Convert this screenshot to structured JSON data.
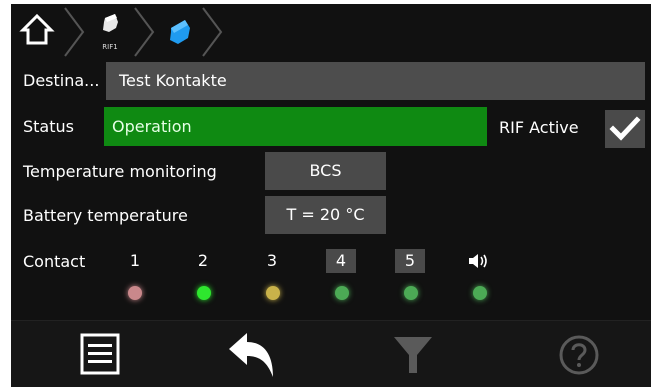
{
  "breadcrumb": {
    "home_icon": "home-icon",
    "item1_label": "RIF1",
    "item1_icon": "device-icon",
    "item2_icon": "device-icon-active"
  },
  "destination": {
    "label": "Destina...",
    "value": "Test Kontakte"
  },
  "status": {
    "label": "Status",
    "value": "Operation",
    "color": "#0f8a12"
  },
  "rif_active": {
    "label": "RIF Active",
    "checked": true
  },
  "temperature_monitoring": {
    "label": "Temperature monitoring",
    "value": "BCS"
  },
  "battery_temperature": {
    "label": "Battery temperature",
    "value": "T = 20 °C"
  },
  "contacts": {
    "label": "Contact",
    "items": [
      {
        "number": "1",
        "boxed": false,
        "led_color": "#c9888b"
      },
      {
        "number": "2",
        "boxed": false,
        "led_color": "#2ee62e"
      },
      {
        "number": "3",
        "boxed": false,
        "led_color": "#c9b24a"
      },
      {
        "number": "4",
        "boxed": true,
        "led_color": "#4caa55"
      },
      {
        "number": "5",
        "boxed": true,
        "led_color": "#4caa55"
      }
    ],
    "speaker": {
      "icon": "speaker-icon",
      "led_color": "#4caa55"
    }
  },
  "toolbar": {
    "menu_icon": "menu-list-icon",
    "back_icon": "back-arrow-icon",
    "filter_icon": "filter-icon",
    "help_icon": "help-icon"
  }
}
